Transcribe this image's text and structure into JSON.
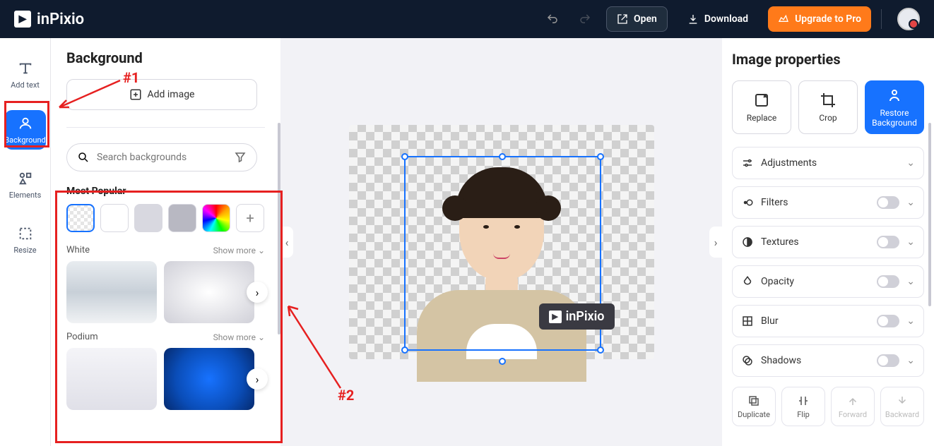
{
  "brand": "inPixio",
  "topbar": {
    "open": "Open",
    "download": "Download",
    "upgrade": "Upgrade to Pro"
  },
  "sidebar": {
    "add_text": "Add text",
    "background": "Background",
    "elements": "Elements",
    "resize": "Resize"
  },
  "panel": {
    "title": "Background",
    "add_image": "Add image",
    "search_placeholder": "Search backgrounds",
    "most_popular": "Most Popular",
    "cat_white": "White",
    "cat_podium": "Podium",
    "show_more": "Show more"
  },
  "watermark": "inPixio",
  "right_panel": {
    "title": "Image properties",
    "replace": "Replace",
    "crop": "Crop",
    "restore": "Restore Background",
    "adjustments": "Adjustments",
    "filters": "Filters",
    "textures": "Textures",
    "opacity": "Opacity",
    "blur": "Blur",
    "shadows": "Shadows",
    "duplicate": "Duplicate",
    "flip": "Flip",
    "forward": "Forward",
    "backward": "Backward"
  },
  "annotations": {
    "a1": "#1",
    "a2": "#2"
  },
  "colors": {
    "primary": "#1772ff",
    "accent": "#ff7a1a",
    "highlight": "#e62020"
  }
}
